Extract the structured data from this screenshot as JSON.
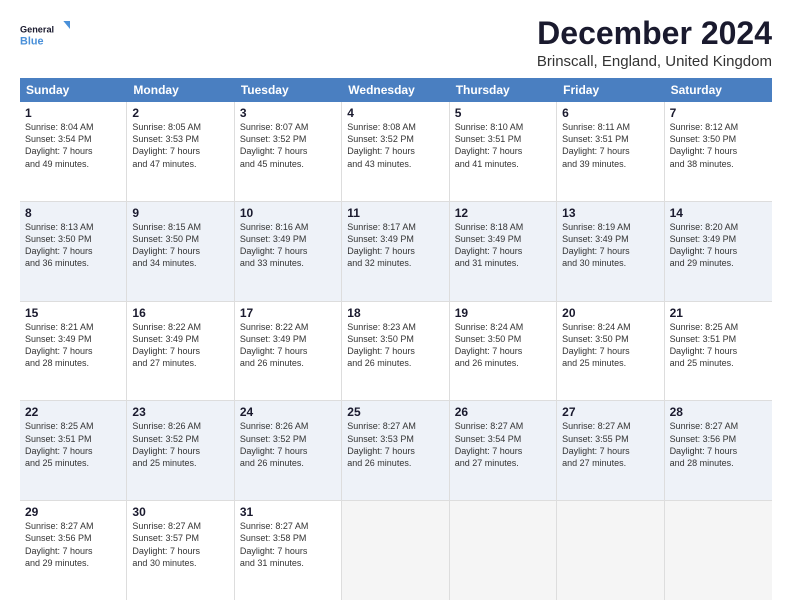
{
  "logo": {
    "line1": "General",
    "line2": "Blue"
  },
  "title": "December 2024",
  "subtitle": "Brinscall, England, United Kingdom",
  "colors": {
    "header_bg": "#4a7fc1",
    "alt_row_bg": "#eef2f8"
  },
  "days_of_week": [
    "Sunday",
    "Monday",
    "Tuesday",
    "Wednesday",
    "Thursday",
    "Friday",
    "Saturday"
  ],
  "weeks": [
    [
      {
        "day": "1",
        "lines": [
          "Sunrise: 8:04 AM",
          "Sunset: 3:54 PM",
          "Daylight: 7 hours",
          "and 49 minutes."
        ]
      },
      {
        "day": "2",
        "lines": [
          "Sunrise: 8:05 AM",
          "Sunset: 3:53 PM",
          "Daylight: 7 hours",
          "and 47 minutes."
        ]
      },
      {
        "day": "3",
        "lines": [
          "Sunrise: 8:07 AM",
          "Sunset: 3:52 PM",
          "Daylight: 7 hours",
          "and 45 minutes."
        ]
      },
      {
        "day": "4",
        "lines": [
          "Sunrise: 8:08 AM",
          "Sunset: 3:52 PM",
          "Daylight: 7 hours",
          "and 43 minutes."
        ]
      },
      {
        "day": "5",
        "lines": [
          "Sunrise: 8:10 AM",
          "Sunset: 3:51 PM",
          "Daylight: 7 hours",
          "and 41 minutes."
        ]
      },
      {
        "day": "6",
        "lines": [
          "Sunrise: 8:11 AM",
          "Sunset: 3:51 PM",
          "Daylight: 7 hours",
          "and 39 minutes."
        ]
      },
      {
        "day": "7",
        "lines": [
          "Sunrise: 8:12 AM",
          "Sunset: 3:50 PM",
          "Daylight: 7 hours",
          "and 38 minutes."
        ]
      }
    ],
    [
      {
        "day": "8",
        "lines": [
          "Sunrise: 8:13 AM",
          "Sunset: 3:50 PM",
          "Daylight: 7 hours",
          "and 36 minutes."
        ]
      },
      {
        "day": "9",
        "lines": [
          "Sunrise: 8:15 AM",
          "Sunset: 3:50 PM",
          "Daylight: 7 hours",
          "and 34 minutes."
        ]
      },
      {
        "day": "10",
        "lines": [
          "Sunrise: 8:16 AM",
          "Sunset: 3:49 PM",
          "Daylight: 7 hours",
          "and 33 minutes."
        ]
      },
      {
        "day": "11",
        "lines": [
          "Sunrise: 8:17 AM",
          "Sunset: 3:49 PM",
          "Daylight: 7 hours",
          "and 32 minutes."
        ]
      },
      {
        "day": "12",
        "lines": [
          "Sunrise: 8:18 AM",
          "Sunset: 3:49 PM",
          "Daylight: 7 hours",
          "and 31 minutes."
        ]
      },
      {
        "day": "13",
        "lines": [
          "Sunrise: 8:19 AM",
          "Sunset: 3:49 PM",
          "Daylight: 7 hours",
          "and 30 minutes."
        ]
      },
      {
        "day": "14",
        "lines": [
          "Sunrise: 8:20 AM",
          "Sunset: 3:49 PM",
          "Daylight: 7 hours",
          "and 29 minutes."
        ]
      }
    ],
    [
      {
        "day": "15",
        "lines": [
          "Sunrise: 8:21 AM",
          "Sunset: 3:49 PM",
          "Daylight: 7 hours",
          "and 28 minutes."
        ]
      },
      {
        "day": "16",
        "lines": [
          "Sunrise: 8:22 AM",
          "Sunset: 3:49 PM",
          "Daylight: 7 hours",
          "and 27 minutes."
        ]
      },
      {
        "day": "17",
        "lines": [
          "Sunrise: 8:22 AM",
          "Sunset: 3:49 PM",
          "Daylight: 7 hours",
          "and 26 minutes."
        ]
      },
      {
        "day": "18",
        "lines": [
          "Sunrise: 8:23 AM",
          "Sunset: 3:50 PM",
          "Daylight: 7 hours",
          "and 26 minutes."
        ]
      },
      {
        "day": "19",
        "lines": [
          "Sunrise: 8:24 AM",
          "Sunset: 3:50 PM",
          "Daylight: 7 hours",
          "and 26 minutes."
        ]
      },
      {
        "day": "20",
        "lines": [
          "Sunrise: 8:24 AM",
          "Sunset: 3:50 PM",
          "Daylight: 7 hours",
          "and 25 minutes."
        ]
      },
      {
        "day": "21",
        "lines": [
          "Sunrise: 8:25 AM",
          "Sunset: 3:51 PM",
          "Daylight: 7 hours",
          "and 25 minutes."
        ]
      }
    ],
    [
      {
        "day": "22",
        "lines": [
          "Sunrise: 8:25 AM",
          "Sunset: 3:51 PM",
          "Daylight: 7 hours",
          "and 25 minutes."
        ]
      },
      {
        "day": "23",
        "lines": [
          "Sunrise: 8:26 AM",
          "Sunset: 3:52 PM",
          "Daylight: 7 hours",
          "and 25 minutes."
        ]
      },
      {
        "day": "24",
        "lines": [
          "Sunrise: 8:26 AM",
          "Sunset: 3:52 PM",
          "Daylight: 7 hours",
          "and 26 minutes."
        ]
      },
      {
        "day": "25",
        "lines": [
          "Sunrise: 8:27 AM",
          "Sunset: 3:53 PM",
          "Daylight: 7 hours",
          "and 26 minutes."
        ]
      },
      {
        "day": "26",
        "lines": [
          "Sunrise: 8:27 AM",
          "Sunset: 3:54 PM",
          "Daylight: 7 hours",
          "and 27 minutes."
        ]
      },
      {
        "day": "27",
        "lines": [
          "Sunrise: 8:27 AM",
          "Sunset: 3:55 PM",
          "Daylight: 7 hours",
          "and 27 minutes."
        ]
      },
      {
        "day": "28",
        "lines": [
          "Sunrise: 8:27 AM",
          "Sunset: 3:56 PM",
          "Daylight: 7 hours",
          "and 28 minutes."
        ]
      }
    ],
    [
      {
        "day": "29",
        "lines": [
          "Sunrise: 8:27 AM",
          "Sunset: 3:56 PM",
          "Daylight: 7 hours",
          "and 29 minutes."
        ]
      },
      {
        "day": "30",
        "lines": [
          "Sunrise: 8:27 AM",
          "Sunset: 3:57 PM",
          "Daylight: 7 hours",
          "and 30 minutes."
        ]
      },
      {
        "day": "31",
        "lines": [
          "Sunrise: 8:27 AM",
          "Sunset: 3:58 PM",
          "Daylight: 7 hours",
          "and 31 minutes."
        ]
      },
      {
        "day": "",
        "lines": []
      },
      {
        "day": "",
        "lines": []
      },
      {
        "day": "",
        "lines": []
      },
      {
        "day": "",
        "lines": []
      }
    ]
  ]
}
